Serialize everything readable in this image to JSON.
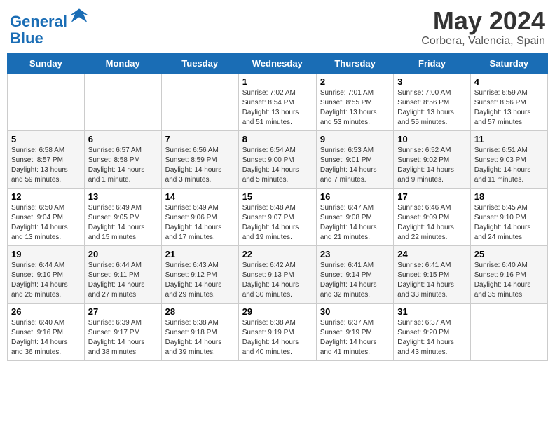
{
  "header": {
    "logo_line1": "General",
    "logo_line2": "Blue",
    "month_year": "May 2024",
    "location": "Corbera, Valencia, Spain"
  },
  "days_of_week": [
    "Sunday",
    "Monday",
    "Tuesday",
    "Wednesday",
    "Thursday",
    "Friday",
    "Saturday"
  ],
  "weeks": [
    [
      {
        "day": "",
        "info": ""
      },
      {
        "day": "",
        "info": ""
      },
      {
        "day": "",
        "info": ""
      },
      {
        "day": "1",
        "info": "Sunrise: 7:02 AM\nSunset: 8:54 PM\nDaylight: 13 hours\nand 51 minutes."
      },
      {
        "day": "2",
        "info": "Sunrise: 7:01 AM\nSunset: 8:55 PM\nDaylight: 13 hours\nand 53 minutes."
      },
      {
        "day": "3",
        "info": "Sunrise: 7:00 AM\nSunset: 8:56 PM\nDaylight: 13 hours\nand 55 minutes."
      },
      {
        "day": "4",
        "info": "Sunrise: 6:59 AM\nSunset: 8:56 PM\nDaylight: 13 hours\nand 57 minutes."
      }
    ],
    [
      {
        "day": "5",
        "info": "Sunrise: 6:58 AM\nSunset: 8:57 PM\nDaylight: 13 hours\nand 59 minutes."
      },
      {
        "day": "6",
        "info": "Sunrise: 6:57 AM\nSunset: 8:58 PM\nDaylight: 14 hours\nand 1 minute."
      },
      {
        "day": "7",
        "info": "Sunrise: 6:56 AM\nSunset: 8:59 PM\nDaylight: 14 hours\nand 3 minutes."
      },
      {
        "day": "8",
        "info": "Sunrise: 6:54 AM\nSunset: 9:00 PM\nDaylight: 14 hours\nand 5 minutes."
      },
      {
        "day": "9",
        "info": "Sunrise: 6:53 AM\nSunset: 9:01 PM\nDaylight: 14 hours\nand 7 minutes."
      },
      {
        "day": "10",
        "info": "Sunrise: 6:52 AM\nSunset: 9:02 PM\nDaylight: 14 hours\nand 9 minutes."
      },
      {
        "day": "11",
        "info": "Sunrise: 6:51 AM\nSunset: 9:03 PM\nDaylight: 14 hours\nand 11 minutes."
      }
    ],
    [
      {
        "day": "12",
        "info": "Sunrise: 6:50 AM\nSunset: 9:04 PM\nDaylight: 14 hours\nand 13 minutes."
      },
      {
        "day": "13",
        "info": "Sunrise: 6:49 AM\nSunset: 9:05 PM\nDaylight: 14 hours\nand 15 minutes."
      },
      {
        "day": "14",
        "info": "Sunrise: 6:49 AM\nSunset: 9:06 PM\nDaylight: 14 hours\nand 17 minutes."
      },
      {
        "day": "15",
        "info": "Sunrise: 6:48 AM\nSunset: 9:07 PM\nDaylight: 14 hours\nand 19 minutes."
      },
      {
        "day": "16",
        "info": "Sunrise: 6:47 AM\nSunset: 9:08 PM\nDaylight: 14 hours\nand 21 minutes."
      },
      {
        "day": "17",
        "info": "Sunrise: 6:46 AM\nSunset: 9:09 PM\nDaylight: 14 hours\nand 22 minutes."
      },
      {
        "day": "18",
        "info": "Sunrise: 6:45 AM\nSunset: 9:10 PM\nDaylight: 14 hours\nand 24 minutes."
      }
    ],
    [
      {
        "day": "19",
        "info": "Sunrise: 6:44 AM\nSunset: 9:10 PM\nDaylight: 14 hours\nand 26 minutes."
      },
      {
        "day": "20",
        "info": "Sunrise: 6:44 AM\nSunset: 9:11 PM\nDaylight: 14 hours\nand 27 minutes."
      },
      {
        "day": "21",
        "info": "Sunrise: 6:43 AM\nSunset: 9:12 PM\nDaylight: 14 hours\nand 29 minutes."
      },
      {
        "day": "22",
        "info": "Sunrise: 6:42 AM\nSunset: 9:13 PM\nDaylight: 14 hours\nand 30 minutes."
      },
      {
        "day": "23",
        "info": "Sunrise: 6:41 AM\nSunset: 9:14 PM\nDaylight: 14 hours\nand 32 minutes."
      },
      {
        "day": "24",
        "info": "Sunrise: 6:41 AM\nSunset: 9:15 PM\nDaylight: 14 hours\nand 33 minutes."
      },
      {
        "day": "25",
        "info": "Sunrise: 6:40 AM\nSunset: 9:16 PM\nDaylight: 14 hours\nand 35 minutes."
      }
    ],
    [
      {
        "day": "26",
        "info": "Sunrise: 6:40 AM\nSunset: 9:16 PM\nDaylight: 14 hours\nand 36 minutes."
      },
      {
        "day": "27",
        "info": "Sunrise: 6:39 AM\nSunset: 9:17 PM\nDaylight: 14 hours\nand 38 minutes."
      },
      {
        "day": "28",
        "info": "Sunrise: 6:38 AM\nSunset: 9:18 PM\nDaylight: 14 hours\nand 39 minutes."
      },
      {
        "day": "29",
        "info": "Sunrise: 6:38 AM\nSunset: 9:19 PM\nDaylight: 14 hours\nand 40 minutes."
      },
      {
        "day": "30",
        "info": "Sunrise: 6:37 AM\nSunset: 9:19 PM\nDaylight: 14 hours\nand 41 minutes."
      },
      {
        "day": "31",
        "info": "Sunrise: 6:37 AM\nSunset: 9:20 PM\nDaylight: 14 hours\nand 43 minutes."
      },
      {
        "day": "",
        "info": ""
      }
    ]
  ]
}
